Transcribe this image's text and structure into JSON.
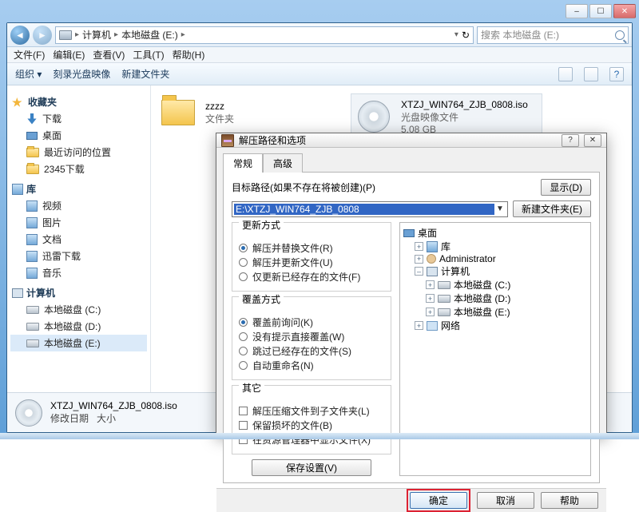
{
  "window_controls": {
    "min": "–",
    "max": "☐",
    "close": "✕"
  },
  "nav": {
    "back": "◄",
    "fwd": "►",
    "crumbs": [
      "计算机",
      "本地磁盘 (E:)"
    ],
    "refresh": "↻",
    "search_placeholder": "搜索 本地磁盘 (E:)"
  },
  "menubar": [
    "文件(F)",
    "编辑(E)",
    "查看(V)",
    "工具(T)",
    "帮助(H)"
  ],
  "toolbar": {
    "organize": "组织 ▾",
    "burn": "刻录光盘映像",
    "newfolder": "新建文件夹"
  },
  "sidebar": {
    "fav": {
      "head": "收藏夹",
      "items": [
        "下载",
        "桌面",
        "最近访问的位置",
        "2345下载"
      ]
    },
    "lib": {
      "head": "库",
      "items": [
        "视频",
        "图片",
        "文档",
        "迅雷下载",
        "音乐"
      ]
    },
    "pc": {
      "head": "计算机",
      "items": [
        "本地磁盘 (C:)",
        "本地磁盘 (D:)",
        "本地磁盘 (E:)"
      ]
    }
  },
  "files": {
    "folder": {
      "name": "zzzz",
      "sub": "文件夹"
    },
    "iso": {
      "name": "XTZJ_WIN764_ZJB_0808.iso",
      "type": "光盘映像文件",
      "size": "5.08 GB"
    }
  },
  "details": {
    "name": "XTZJ_WIN764_ZJB_0808.iso",
    "label_date": "修改日期",
    "label_size": "大小"
  },
  "dlg": {
    "title": "解压路径和选项",
    "help_q": "?",
    "close_x": "✕",
    "tabs": {
      "general": "常规",
      "advanced": "高级"
    },
    "path_label": "目标路径(如果不存在将被创建)(P)",
    "btn_show": "显示(D)",
    "btn_newfolder": "新建文件夹(E)",
    "path_value": "E:\\XTZJ_WIN764_ZJB_0808",
    "update": {
      "title": "更新方式",
      "r1": "解压并替换文件(R)",
      "r2": "解压并更新文件(U)",
      "r3": "仅更新已经存在的文件(F)"
    },
    "overwrite": {
      "title": "覆盖方式",
      "r1": "覆盖前询问(K)",
      "r2": "没有提示直接覆盖(W)",
      "r3": "跳过已经存在的文件(S)",
      "r4": "自动重命名(N)"
    },
    "other": {
      "title": "其它",
      "c1": "解压压缩文件到子文件夹(L)",
      "c2": "保留损坏的文件(B)",
      "c3": "在资源管理器中显示文件(X)"
    },
    "save": "保存设置(V)",
    "tree": {
      "desktop": "桌面",
      "lib": "库",
      "user": "Administrator",
      "pc": "计算机",
      "drives": [
        "本地磁盘 (C:)",
        "本地磁盘 (D:)",
        "本地磁盘 (E:)"
      ],
      "net": "网络"
    },
    "ok": "确定",
    "cancel": "取消",
    "help": "帮助"
  }
}
